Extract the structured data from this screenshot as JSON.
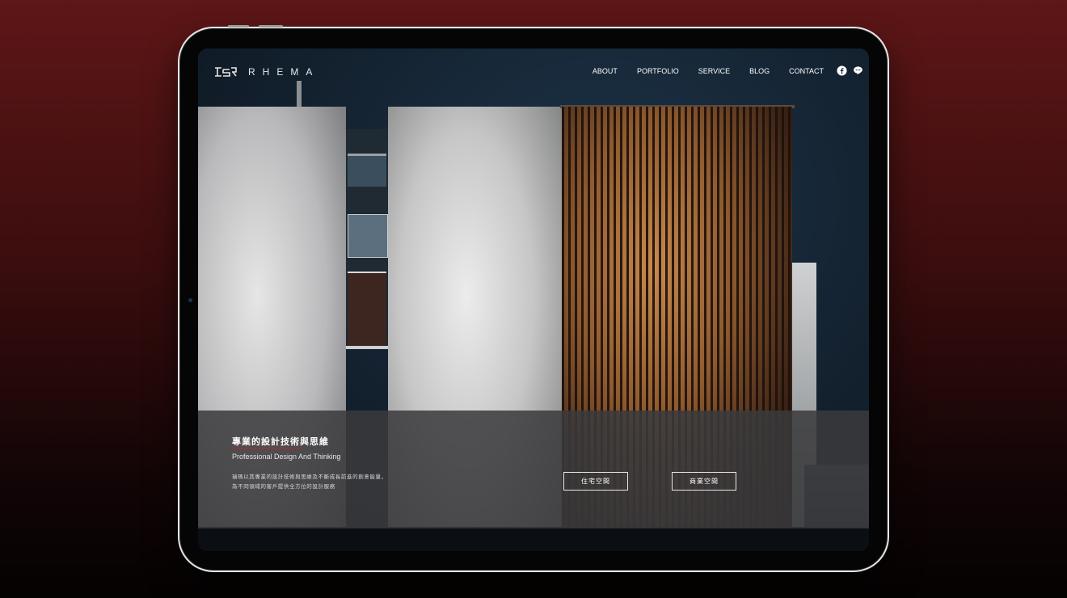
{
  "brand": {
    "name": "RHEMA"
  },
  "nav": {
    "items": [
      {
        "label": "ABOUT"
      },
      {
        "label": "PORTFOLIO"
      },
      {
        "label": "SERVICE"
      },
      {
        "label": "BLOG"
      },
      {
        "label": "CONTACT"
      }
    ]
  },
  "social": {
    "icons": [
      "facebook-icon",
      "line-icon"
    ]
  },
  "hero": {
    "title": "專業的設計技術與思維",
    "subtitle": "Professional Design And Thinking",
    "description_line1": "瑞瑪以其專業的設計技術與思維及不斷成長前進的創意能量，",
    "description_line2": "為不同領域的客戶提供全方位的設計服務"
  },
  "categories": {
    "residential": "住宅空間",
    "commercial": "商業空間"
  },
  "colors": {
    "accent": "#c8202a",
    "background_top": "#5e1617",
    "background_bottom": "#050202"
  }
}
